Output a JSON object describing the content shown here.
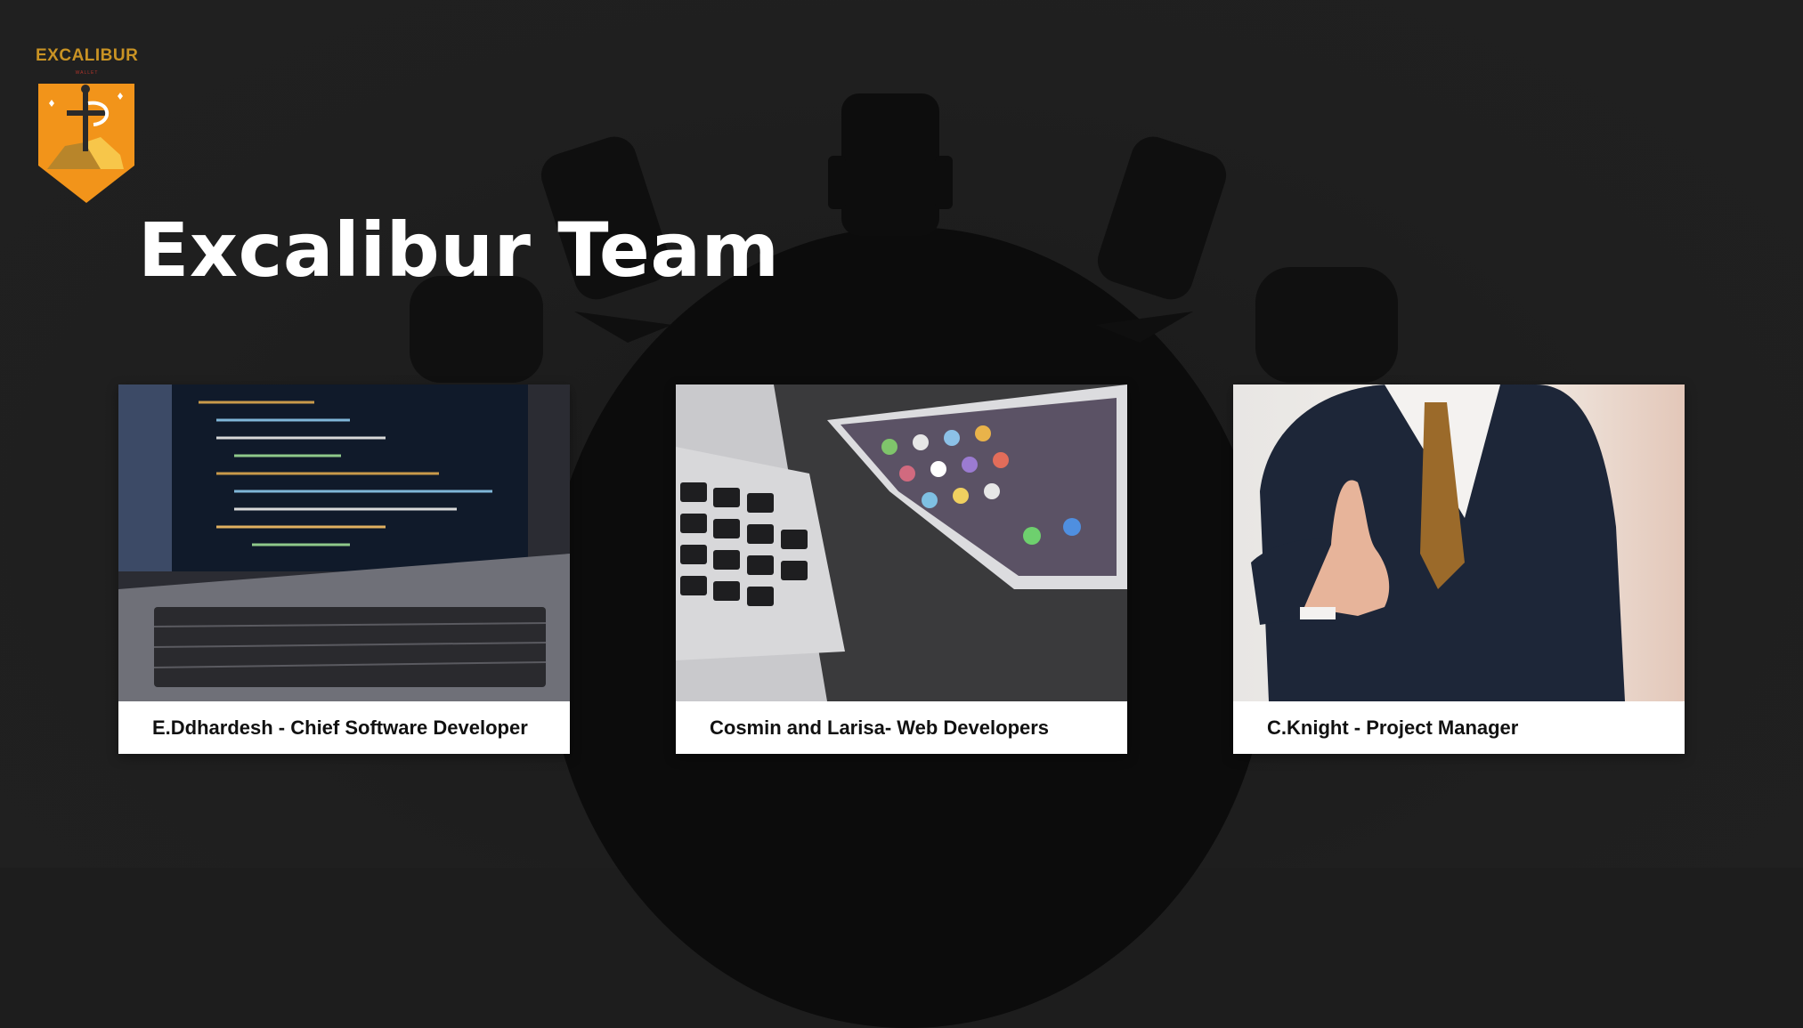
{
  "logo": {
    "wordmark": "EXCALIBUR",
    "sub": "WALLET"
  },
  "title": "Excalibur Team",
  "cards": [
    {
      "caption": "E.Ddhardesh - Chief Software Developer",
      "image": "laptop-code-photo"
    },
    {
      "caption": "Cosmin and Larisa- Web Developers",
      "image": "laptop-tablet-photo"
    },
    {
      "caption": "C.Knight - Project Manager",
      "image": "handshake-photo"
    }
  ],
  "colors": {
    "background": "#1d1d1d",
    "logo_orange": "#f2941a",
    "logo_gold": "#c99324",
    "text": "#ffffff"
  }
}
